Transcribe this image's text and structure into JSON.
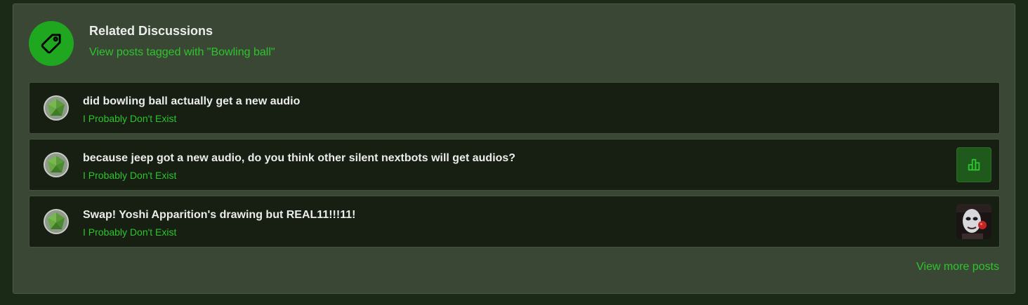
{
  "header": {
    "icon": "tag-icon",
    "title": "Related Discussions",
    "subtitle": "View posts tagged with \"Bowling ball\""
  },
  "posts": [
    {
      "title": "did bowling ball actually get a new audio",
      "author": "I Probably Don't Exist",
      "thumbnail": "none"
    },
    {
      "title": "because jeep got a new audio, do you think other silent nextbots will get audios?",
      "author": "I Probably Don't Exist",
      "thumbnail": "poll-icon"
    },
    {
      "title": "Swap! Yoshi Apparition's drawing but REAL11!!!11!",
      "author": "I Probably Don't Exist",
      "thumbnail": "image"
    }
  ],
  "footer": {
    "view_more": "View more posts"
  },
  "colors": {
    "accent": "#2ec42e",
    "tag_circle": "#1fa81f",
    "panel": "#3a4734",
    "row": "#161f12",
    "page_bg": "#1b2a17"
  }
}
